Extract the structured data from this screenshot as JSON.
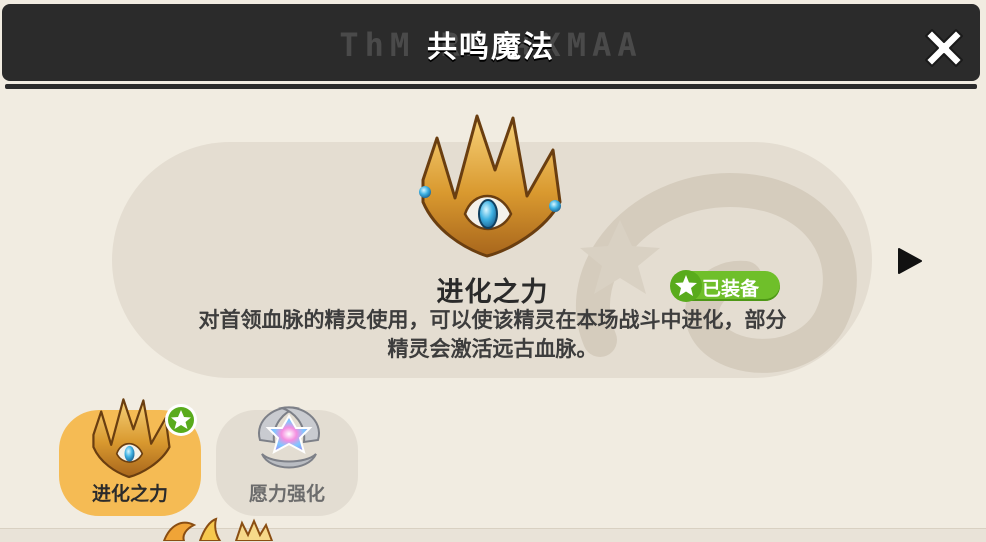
{
  "header": {
    "title": "共鸣魔法",
    "rune_text": "ThM RM   +XMAA"
  },
  "item": {
    "name": "进化之力",
    "status": "已装备",
    "description": "对首领血脉的精灵使用，可以使该精灵在本场战斗中进化，部分精灵会激活远古血脉。"
  },
  "slots": [
    {
      "label": "进化之力",
      "icon": "crown-icon",
      "selected": true,
      "equipped": true
    },
    {
      "label": "愿力强化",
      "icon": "wish-gem-icon",
      "selected": false,
      "equipped": false
    }
  ],
  "colors": {
    "header_bg": "#2b2b2b",
    "page_bg": "#f1ece1",
    "card_bg": "#e4ddd1",
    "equipped_green": "#6fbf2a",
    "selected_slot": "#f5bb54"
  },
  "icons": {
    "close": "close-icon",
    "next": "play-arrow-icon",
    "badge_star": "star-icon"
  }
}
